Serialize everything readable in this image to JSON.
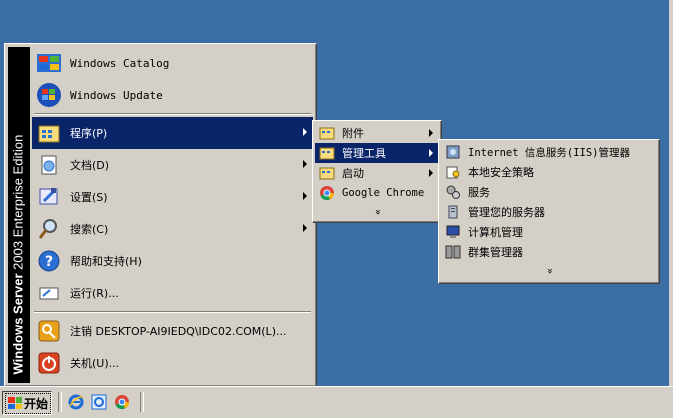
{
  "start_menu": {
    "banner_bold": "Windows Server",
    "banner_light": " 2003 ",
    "banner_edition": "Enterprise Edition",
    "top_items": [
      {
        "label": "Windows Catalog",
        "icon": "catalog-icon"
      },
      {
        "label": "Windows Update",
        "icon": "windows-update-icon"
      }
    ],
    "items": [
      {
        "label": "程序(P)",
        "icon": "programs-icon",
        "submenu": true
      },
      {
        "label": "文档(D)",
        "icon": "documents-icon",
        "submenu": true
      },
      {
        "label": "设置(S)",
        "icon": "settings-icon",
        "submenu": true
      },
      {
        "label": "搜索(C)",
        "icon": "search-icon",
        "submenu": true
      },
      {
        "label": "帮助和支持(H)",
        "icon": "help-icon",
        "submenu": false
      },
      {
        "label": "运行(R)...",
        "icon": "run-icon",
        "submenu": false
      }
    ],
    "bottom_items": [
      {
        "label": "注销 DESKTOP-AI9IEDQ\\IDC02.COM(L)...",
        "icon": "logoff-icon"
      },
      {
        "label": "关机(U)...",
        "icon": "shutdown-icon"
      }
    ]
  },
  "programs_submenu": {
    "items": [
      {
        "label": "附件",
        "icon": "folder-icon",
        "submenu": true
      },
      {
        "label": "管理工具",
        "icon": "folder-icon",
        "submenu": true
      },
      {
        "label": "启动",
        "icon": "folder-icon",
        "submenu": true
      },
      {
        "label": "Google Chrome",
        "icon": "chrome-icon",
        "submenu": false
      }
    ],
    "more": "»"
  },
  "admin_tools_submenu": {
    "items": [
      {
        "label": "Internet 信息服务(IIS)管理器",
        "icon": "iis-icon"
      },
      {
        "label": "本地安全策略",
        "icon": "security-policy-icon"
      },
      {
        "label": "服务",
        "icon": "services-icon"
      },
      {
        "label": "管理您的服务器",
        "icon": "manage-server-icon"
      },
      {
        "label": "计算机管理",
        "icon": "computer-management-icon"
      },
      {
        "label": "群集管理器",
        "icon": "cluster-manager-icon"
      }
    ],
    "more": "»"
  },
  "taskbar": {
    "start_label": "开始",
    "quick_launch": [
      "internet-explorer-icon",
      "ie-browser-icon",
      "chrome-icon"
    ]
  },
  "colors": {
    "desktop": "#3a6ea5",
    "selection": "#0a246a",
    "face": "#d4d0c8"
  }
}
